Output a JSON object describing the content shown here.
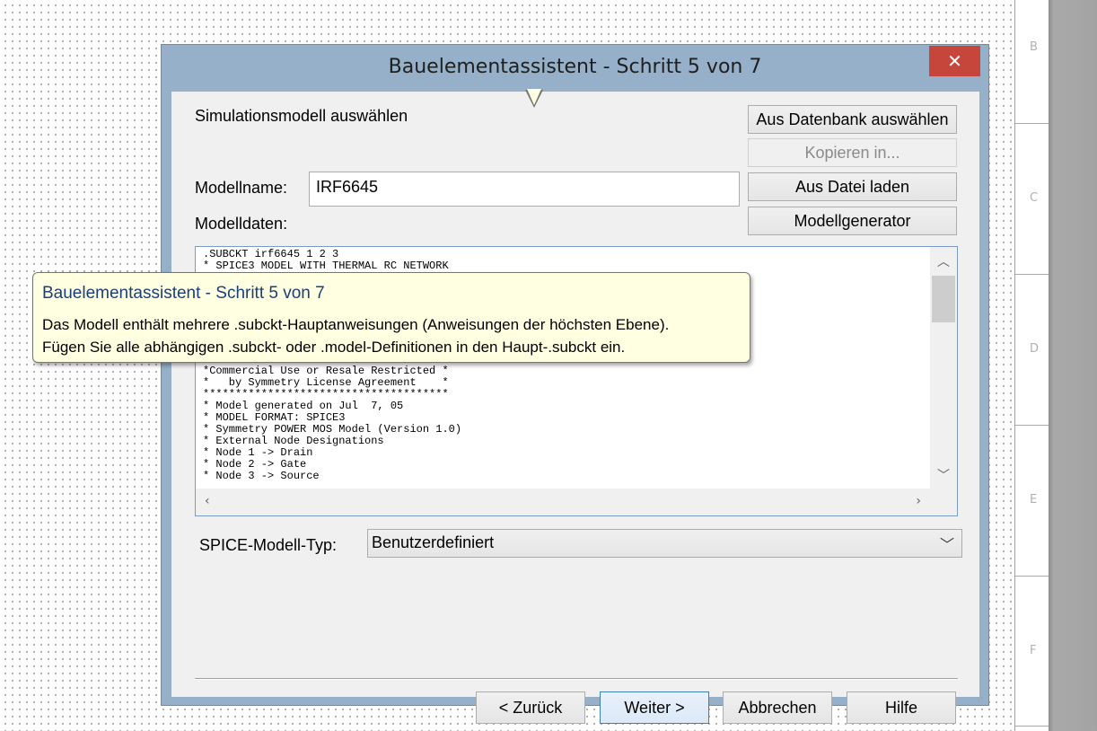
{
  "ruler": {
    "labels": [
      "B",
      "C",
      "D",
      "E",
      "F"
    ]
  },
  "dialog": {
    "title": "Bauelementassistent - Schritt 5 von 7",
    "close_glyph": "✕",
    "section_label": "Simulationsmodell auswählen",
    "model_name_label": "Modellname:",
    "model_name_value": "IRF6645",
    "model_data_label": "Modelldaten:",
    "buttons": {
      "from_database": "Aus Datenbank auswählen",
      "copy_to": "Kopieren in...",
      "load_file": "Aus Datei laden",
      "model_generator": "Modellgenerator"
    },
    "model_data_lines": [
      ".SUBCKT irf6645 1 2 3",
      "* SPICE3 MODEL WITH THERMAL RC NETWORK",
      "",
      "",
      "",
      "",
      "",
      "",
      "",
      "",
      "*Commercial Use or Resale Restricted *",
      "*   by Symmetry License Agreement    *",
      "**************************************",
      "* Model generated on Jul  7, 05",
      "* MODEL FORMAT: SPICE3",
      "* Symmetry POWER MOS Model (Version 1.0)",
      "* External Node Designations",
      "* Node 1 -> Drain",
      "* Node 2 -> Gate",
      "* Node 3 -> Source"
    ],
    "spice_type_label": "SPICE-Modell-Typ:",
    "spice_type_value": "Benutzerdefiniert",
    "nav": {
      "back": "< Zurück",
      "next": "Weiter >",
      "cancel": "Abbrechen",
      "help": "Hilfe"
    }
  },
  "tooltip": {
    "title": "Bauelementassistent - Schritt 5 von 7",
    "line1": "Das Modell enthält mehrere .subckt-Hauptanweisungen (Anweisungen der höchsten Ebene).",
    "line2": "Fügen Sie alle abhängigen .subckt- oder .model-Definitionen in den Haupt-.subckt ein."
  },
  "colors": {
    "accent": "#3c7fb1",
    "close": "#c7463c",
    "titlebar": "#95b0c8",
    "tooltip_bg": "#ffffe1"
  }
}
